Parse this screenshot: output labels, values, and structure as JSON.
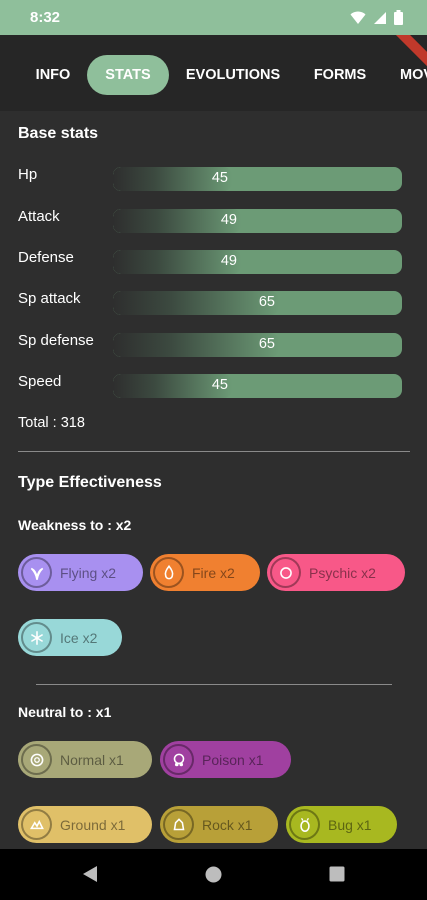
{
  "status_bar": {
    "time": "8:32"
  },
  "tabs": [
    {
      "label": "INFO",
      "active": false
    },
    {
      "label": "STATS",
      "active": true
    },
    {
      "label": "EVOLUTIONS",
      "active": false
    },
    {
      "label": "FORMS",
      "active": false
    },
    {
      "label": "MOV",
      "active": false
    }
  ],
  "base_stats": {
    "title": "Base stats",
    "stats": [
      {
        "label": "Hp",
        "value": "45",
        "fraction": 0.45
      },
      {
        "label": "Attack",
        "value": "49",
        "fraction": 0.49
      },
      {
        "label": "Defense",
        "value": "49",
        "fraction": 0.49
      },
      {
        "label": "Sp attack",
        "value": "65",
        "fraction": 0.65
      },
      {
        "label": "Sp defense",
        "value": "65",
        "fraction": 0.65
      },
      {
        "label": "Speed",
        "value": "45",
        "fraction": 0.45
      }
    ],
    "total": "Total : 318"
  },
  "type_effectiveness": {
    "title": "Type Effectiveness",
    "weakness_label": "Weakness to : x2",
    "weakness": [
      {
        "label": "Flying x2",
        "color": "#a890f0",
        "icon": "flying-type-icon"
      },
      {
        "label": "Fire x2",
        "color": "#f08030",
        "icon": "fire-type-icon"
      },
      {
        "label": "Psychic x2",
        "color": "#f85888",
        "icon": "psychic-type-icon"
      },
      {
        "label": "Ice x2",
        "color": "#98d8d8",
        "icon": "ice-type-icon"
      }
    ],
    "neutral_label": "Neutral to : x1",
    "neutral": [
      {
        "label": "Normal x1",
        "color": "#a8a878",
        "icon": "normal-type-icon"
      },
      {
        "label": "Poison x1",
        "color": "#a040a0",
        "icon": "poison-type-icon"
      },
      {
        "label": "Ground x1",
        "color": "#e0c068",
        "icon": "ground-type-icon"
      },
      {
        "label": "Rock x1",
        "color": "#b8a038",
        "icon": "rock-type-icon"
      },
      {
        "label": "Bug x1",
        "color": "#a8b820",
        "icon": "bug-type-icon"
      }
    ]
  },
  "colors": {
    "accent": "#8fbf9b",
    "stat_bar": "#6c9b76",
    "background": "#2e2e2e"
  }
}
